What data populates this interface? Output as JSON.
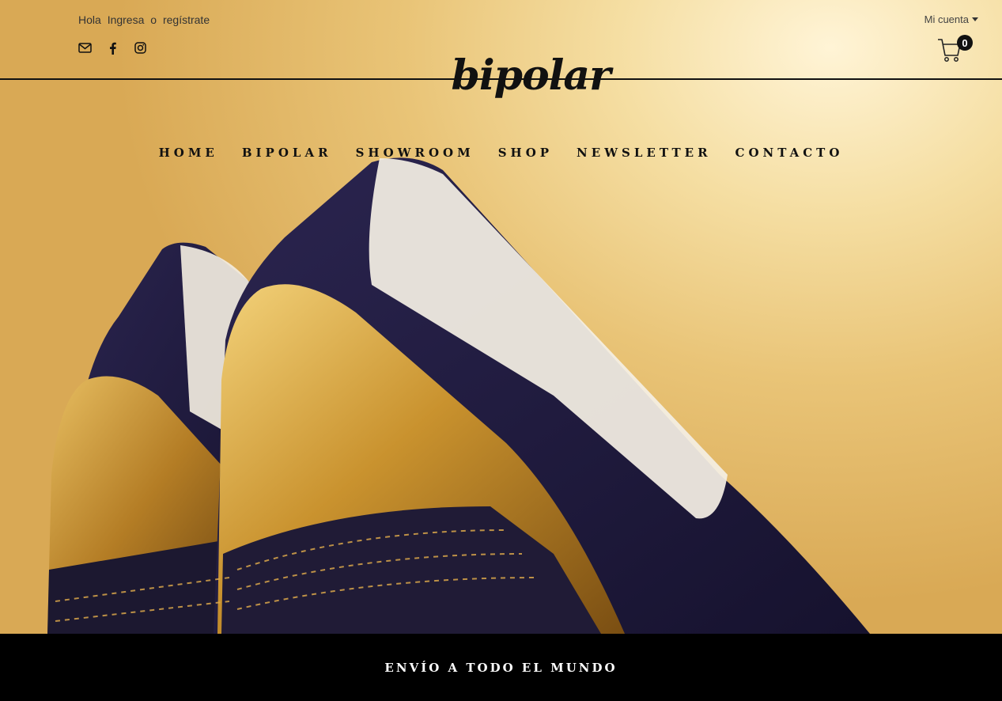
{
  "header": {
    "greeting": "Hola",
    "login_link": "Ingresa",
    "or_text": "o",
    "register_link": "regístrate",
    "account_label": "Mi cuenta",
    "cart_count": "0",
    "logo_text": "bipolar"
  },
  "social": [
    {
      "icon": "envelope-icon"
    },
    {
      "icon": "facebook-icon"
    },
    {
      "icon": "instagram-icon"
    }
  ],
  "nav": {
    "items": [
      "HOME",
      "BIPOLAR",
      "SHOWROOM",
      "SHOP",
      "NEWSLETTER",
      "CONTACTO"
    ]
  },
  "banner": {
    "text": "ENVÍO A TODO EL MUNDO"
  },
  "colors": {
    "background": "#e9c477",
    "text": "#111111",
    "banner_bg": "#000000",
    "banner_text": "#ffffff"
  }
}
